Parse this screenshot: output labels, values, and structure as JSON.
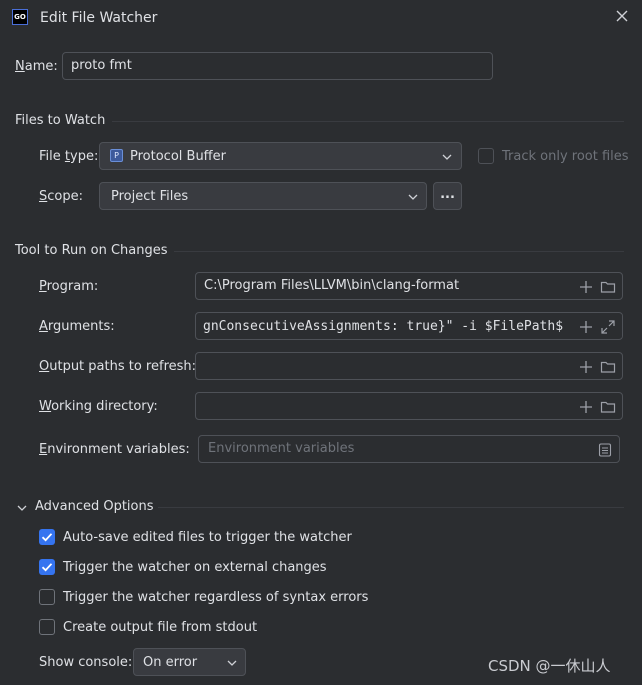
{
  "window": {
    "app_icon_text": "GO",
    "title": "Edit File Watcher"
  },
  "name": {
    "label": "Name:",
    "value": "proto fmt"
  },
  "files_to_watch": {
    "section_title": "Files to Watch",
    "file_type_label": "File type:",
    "file_type_icon_text": "P",
    "file_type_value": "Protocol Buffer",
    "track_only_root_label": "Track only root files",
    "scope_label": "Scope:",
    "scope_value": "Project Files",
    "scope_more_label": "..."
  },
  "tool": {
    "section_title": "Tool to Run on Changes",
    "program_label": "Program:",
    "program_value": "C:\\Program Files\\LLVM\\bin\\clang-format",
    "arguments_label": "Arguments:",
    "arguments_value": "gnConsecutiveAssignments: true}\" -i $FilePath$",
    "output_paths_label": "Output paths to refresh:",
    "output_paths_value": "",
    "working_dir_label": "Working directory:",
    "working_dir_value": "",
    "env_label": "Environment variables:",
    "env_placeholder": "Environment variables"
  },
  "advanced": {
    "section_title": "Advanced Options",
    "options": [
      {
        "label": "Auto-save edited files to trigger the watcher",
        "checked": true
      },
      {
        "label": "Trigger the watcher on external changes",
        "checked": true
      },
      {
        "label": "Trigger the watcher regardless of syntax errors",
        "checked": false
      },
      {
        "label": "Create output file from stdout",
        "checked": false
      }
    ],
    "show_console_label": "Show console:",
    "show_console_value": "On error"
  },
  "overlay_watermark": "CSDN @一休山人",
  "colors": {
    "accent": "#3574f0",
    "background": "#2b2d30",
    "field_border": "#4e5157"
  }
}
